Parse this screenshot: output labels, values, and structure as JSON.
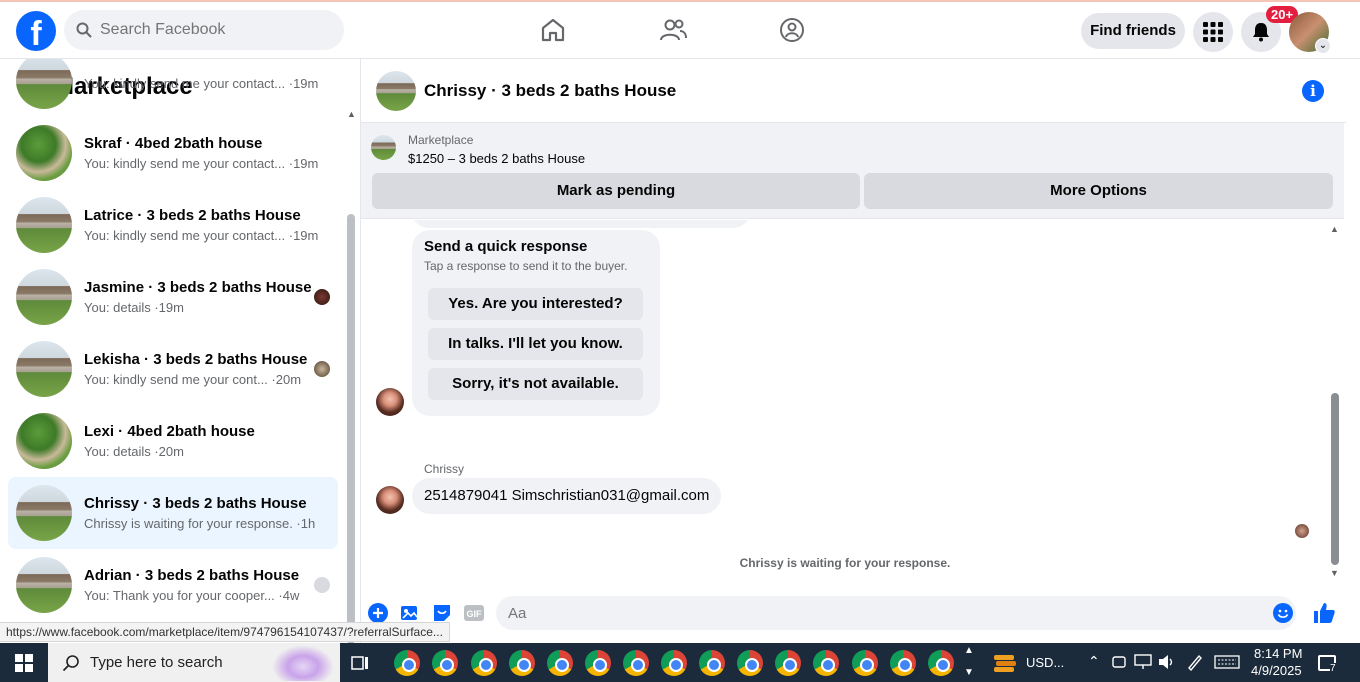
{
  "topbar": {
    "logo_letter": "f",
    "search_placeholder": "Search Facebook",
    "find_friends": "Find friends",
    "notification_badge": "20+"
  },
  "sidebar": {
    "title": "Marketplace",
    "conversations": [
      {
        "name": "",
        "last": "You: kindly send me your contact... ·19m",
        "thumb": "house"
      },
      {
        "name": "Skraf · 4bed 2bath house",
        "last": "You: kindly send me your contact... ·19m",
        "thumb": "green"
      },
      {
        "name": "Latrice · 3 beds 2 baths House",
        "last": "You: kindly send me your contact... ·19m",
        "thumb": "house"
      },
      {
        "name": "Jasmine · 3 beds 2 baths House",
        "last": "You: details ·19m",
        "thumb": "house"
      },
      {
        "name": "Lekisha · 3 beds 2 baths House",
        "last": "You: kindly send me your cont... ·20m",
        "thumb": "house"
      },
      {
        "name": "Lexi · 4bed 2bath house",
        "last": "You: details ·20m",
        "thumb": "green"
      },
      {
        "name": "Chrissy · 3 beds 2 baths House",
        "last": "Chrissy is waiting for your response. ·1h",
        "thumb": "house"
      },
      {
        "name": "Adrian · 3 beds 2 baths House",
        "last": "You: Thank you for your cooper... ·4w",
        "thumb": "house"
      }
    ]
  },
  "chat": {
    "title": "Chrissy · 3 beds 2 baths House",
    "banner_label": "Marketplace",
    "banner_price": "$1250 – 3 beds 2 baths House",
    "mark_pending": "Mark as pending",
    "more_options": "More Options",
    "quick_title": "Send a quick response",
    "quick_subtitle": "Tap a response to send it to the buyer.",
    "quick_replies": [
      "Yes. Are you interested?",
      "In talks. I'll let you know.",
      "Sorry, it's not available."
    ],
    "sender": "Chrissy",
    "message": "2514879041 Simschristian031@gmail.com",
    "waiting": "Chrissy is waiting for your response.",
    "composer_placeholder": "Aa"
  },
  "status_url": "https://www.facebook.com/marketplace/item/974796154107437/?referralSurface...",
  "taskbar": {
    "search_placeholder": "Type here to search",
    "weather": "USD...",
    "time": "8:14 PM",
    "date": "4/9/2025",
    "notification_count": "7"
  },
  "colors": {
    "brand": "#0866ff",
    "badge": "#e41e3f",
    "active_row": "#ebf5ff"
  }
}
